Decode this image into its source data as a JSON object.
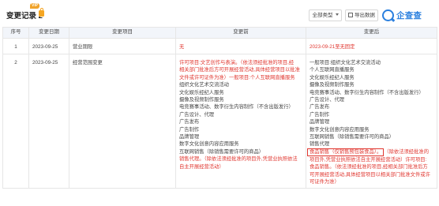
{
  "header": {
    "title": "变更记录 2",
    "vip_badge": "VIP",
    "type_button": "全部类型",
    "export_button": "导出数据",
    "brand": "企查查"
  },
  "table": {
    "columns": [
      "序号",
      "变更日期",
      "变更项目",
      "变更前",
      "变更后"
    ],
    "row1": {
      "index": "1",
      "date": "2023-09-25",
      "item": "营业期限",
      "before": "无",
      "after": "2023-09-21至无固定"
    },
    "row2": {
      "index": "2",
      "date": "2023-09-25",
      "item": "经营范围变更",
      "before_lines": [
        "许可项目:文艺创作与表演。（依法须经批准的项目,经",
        "相关部门批准后方可开展经营活动,具体经营项目以批准",
        "文件或许可证件为准）一般项目:个人互联网直播服务",
        "组织文化艺术交流活动",
        "文化娱乐经纪人服务",
        "摄像及视频制作服务",
        "电竞赛事活动、数字衍生内容制作（不含出版发行）",
        "广告设计、代理",
        "广告发布",
        "广告制作",
        "品牌管理",
        "数字文化创意内容应用服务",
        "互联网销售（除销售需要许可的商品）",
        "销售代理。（除依法须经批准的项目外,凭营业执照依法",
        "自主开展经营活动）"
      ],
      "after_lines": [
        "一般项目:组织文化艺术交流活动",
        "个人互联网直播服务",
        "文化娱乐经纪人服务",
        "摄像及视频制作服务",
        "电竞赛事活动、数字衍生内容制作（不含出版发行）",
        "广告设计、代理",
        "广告发布",
        "广告制作",
        "品牌管理",
        "数字文化创意内容应用服务",
        "互联网销售（除销售需要许可的商品）",
        "销售代理"
      ],
      "after_highlight": "食品销售（仅销售预包装食品）。",
      "after_tail_1": "（除依法须经批准的",
      "after_red_lines": [
        "项目外,凭营业执照依法自主开展经营活动）许可项目:",
        "食品销售。（依法须经批准的项目,经相关部门批准后方",
        "可开展经营活动,具体经营项目以相关部门批准文件或许",
        "可证件为准）"
      ]
    }
  },
  "colors": {
    "red": "#e0362f",
    "brand_blue": "#2a7fde",
    "header_bg": "#f2f5fa",
    "vip_orange": "#f0a32a"
  }
}
